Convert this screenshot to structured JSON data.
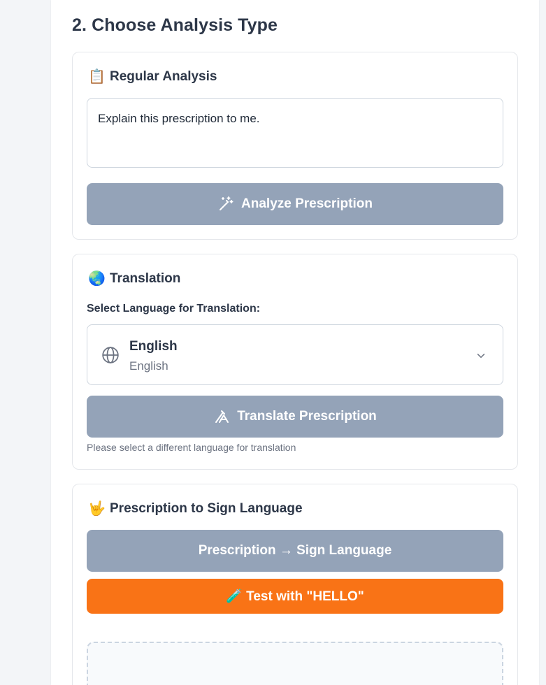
{
  "section": {
    "title": "2. Choose Analysis Type"
  },
  "regular": {
    "title": "Regular Analysis",
    "emoji": "📋",
    "textarea_value": "Explain this prescription to me.",
    "button_label": "Analyze Prescription"
  },
  "translation": {
    "title": "Translation",
    "emoji": "🌏",
    "select_label": "Select Language for Translation:",
    "selected_language": "English",
    "selected_language_native": "English",
    "button_label": "Translate Prescription",
    "hint": "Please select a different language for translation"
  },
  "sign": {
    "title": "Prescription to Sign Language",
    "emoji": "🤟",
    "convert_button_label": "Prescription → Sign Language",
    "test_button_label": "🧪 Test with \"HELLO\""
  },
  "colors": {
    "button_disabled": "#94a3b8",
    "accent_orange": "#f97316"
  },
  "icons": [
    "wand-icon",
    "globe-icon",
    "chevron-down-icon",
    "translate-icon"
  ]
}
